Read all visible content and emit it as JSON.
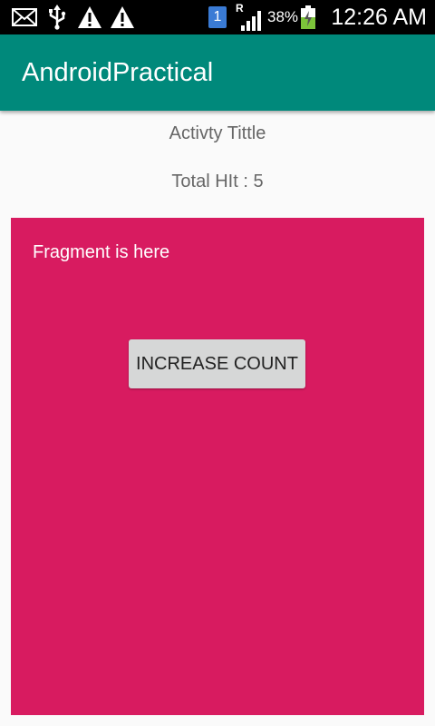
{
  "status_bar": {
    "time": "12:26 AM",
    "battery_percent": "38%",
    "sim_badge": "1",
    "roaming_indicator": "R",
    "icons": [
      "mail-icon",
      "usb-icon",
      "warning-icon",
      "warning-icon",
      "sim-icon",
      "signal-icon",
      "battery-charging-icon"
    ]
  },
  "app_bar": {
    "title": "AndroidPractical",
    "color": "#00897b"
  },
  "main": {
    "activity_title": "Activty Tittle",
    "total_hit": "Total HIt : 5"
  },
  "fragment": {
    "label": "Fragment is here",
    "button_label": "INCREASE COUNT",
    "background": "#d81b60"
  }
}
